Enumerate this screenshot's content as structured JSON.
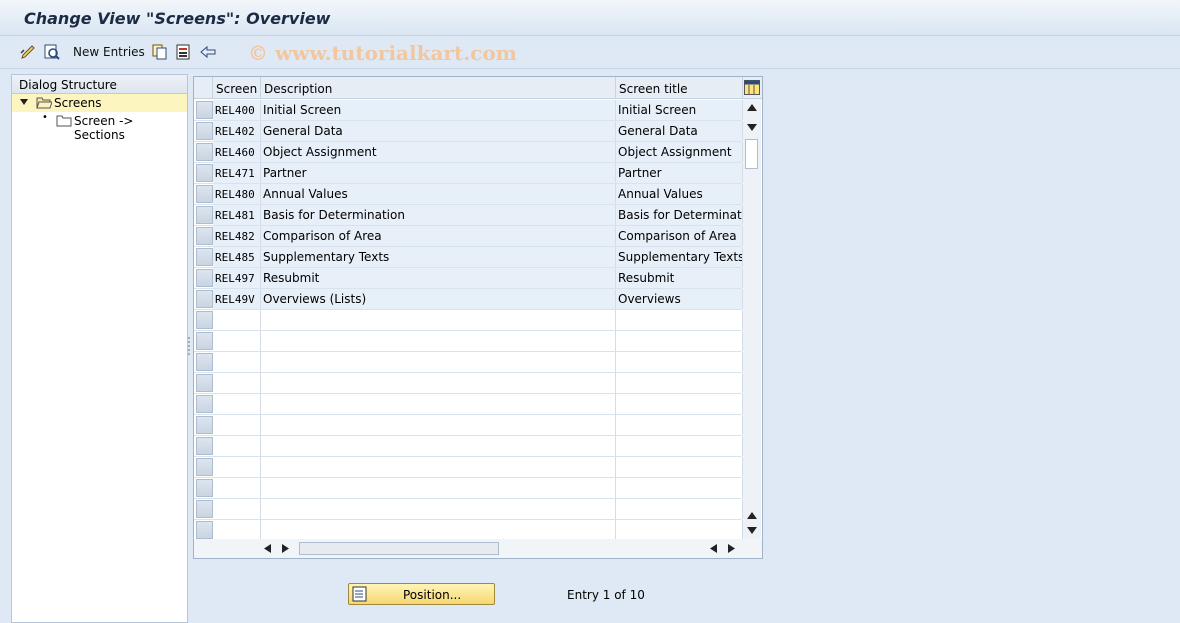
{
  "window": {
    "title": "Change View \"Screens\": Overview"
  },
  "toolbar": {
    "new_entries_label": "New Entries",
    "watermark": "© www.tutorialkart.com",
    "icons": [
      "display-change-icon",
      "details-icon",
      "copy-icon",
      "delete-icon",
      "undo-icon"
    ]
  },
  "dialog_structure": {
    "title": "Dialog Structure",
    "nodes": [
      {
        "label": "Screens",
        "selected": true,
        "expanded": true
      },
      {
        "label": "Screen -> Sections",
        "selected": false
      }
    ]
  },
  "table": {
    "headers": {
      "screen": "Screen",
      "description": "Description",
      "screen_title": "Screen title"
    },
    "rows": [
      {
        "screen": "REL400",
        "description": "Initial Screen",
        "screen_title": "Initial Screen"
      },
      {
        "screen": "REL402",
        "description": "General Data",
        "screen_title": "General Data"
      },
      {
        "screen": "REL460",
        "description": "Object Assignment",
        "screen_title": "Object Assignment"
      },
      {
        "screen": "REL471",
        "description": "Partner",
        "screen_title": "Partner"
      },
      {
        "screen": "REL480",
        "description": "Annual Values",
        "screen_title": "Annual Values"
      },
      {
        "screen": "REL481",
        "description": "Basis for Determination",
        "screen_title": "Basis for Determination"
      },
      {
        "screen": "REL482",
        "description": "Comparison of Area",
        "screen_title": "Comparison of Area"
      },
      {
        "screen": "REL485",
        "description": "Supplementary Texts",
        "screen_title": "Supplementary Texts"
      },
      {
        "screen": "REL497",
        "description": "Resubmit",
        "screen_title": "Resubmit"
      },
      {
        "screen": "REL49V",
        "description": "Overviews (Lists)",
        "screen_title": "Overviews"
      }
    ]
  },
  "footer": {
    "position_label": "Position...",
    "entry_info": "Entry 1 of 10"
  },
  "colors": {
    "background": "#dfe9f5",
    "selected_row": "#fdf5c0",
    "button": "#f5d870"
  }
}
